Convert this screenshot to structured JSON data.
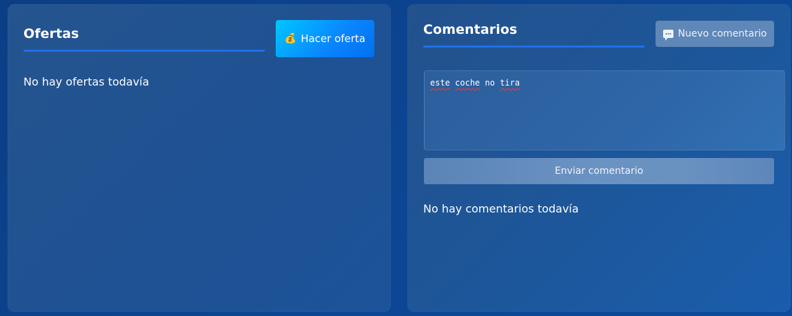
{
  "offers": {
    "title": "Ofertas",
    "make_offer_icon": "money-bag-icon",
    "make_offer_label": "Hacer oferta",
    "empty_text": "No hay ofertas todavía"
  },
  "comments": {
    "title": "Comentarios",
    "new_comment_icon": "speech-bubble-icon",
    "new_comment_label": "Nuevo comentario",
    "input_value_words": [
      "este",
      "coche",
      "no",
      "tira"
    ],
    "send_label": "Enviar comentario",
    "empty_text": "No hay comentarios todavía"
  },
  "colors": {
    "accent_underline": "#1f6fe8",
    "offer_button_gradient_start": "#00c6ff",
    "offer_button_gradient_end": "#0070f0",
    "spellcheck_underline": "#e23a3a"
  }
}
